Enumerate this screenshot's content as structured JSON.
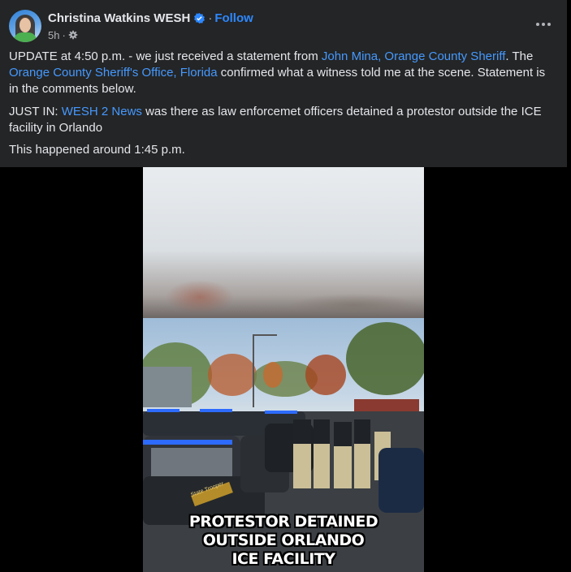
{
  "post": {
    "author": "Christina Watkins WESH",
    "separator": "·",
    "follow_label": "Follow",
    "timestamp": "5h",
    "audience_icon": "gear-icon",
    "more_icon": "more-options-icon",
    "paragraph1": {
      "part1": "UPDATE at 4:50 p.m. - we just received a statement from ",
      "link1": "John Mina, Orange County Sheriff",
      "part2": ". The ",
      "link2": "Orange County Sheriff's Office, Florida",
      "part3": " confirmed what a witness told me at the scene. Statement is in the comments below."
    },
    "paragraph2": {
      "part1": "JUST IN: ",
      "link1": "WESH 2 News",
      "part2": " was there as law enforcemet officers detained a protestor outside the ICE facility in Orlando"
    },
    "paragraph3": "This happened around 1:45 p.m."
  },
  "video": {
    "caption_line1": "PROTESTOR DETAINED",
    "caption_line2": "OUTSIDE ORLANDO",
    "caption_line3": "ICE FACILITY",
    "car_door_text": "State Trooper"
  },
  "colors": {
    "card_bg": "#242526",
    "page_bg": "#000000",
    "link": "#4599ff",
    "follow": "#2d88ff",
    "text": "#e4e6eb",
    "secondary": "#b0b3b8"
  }
}
